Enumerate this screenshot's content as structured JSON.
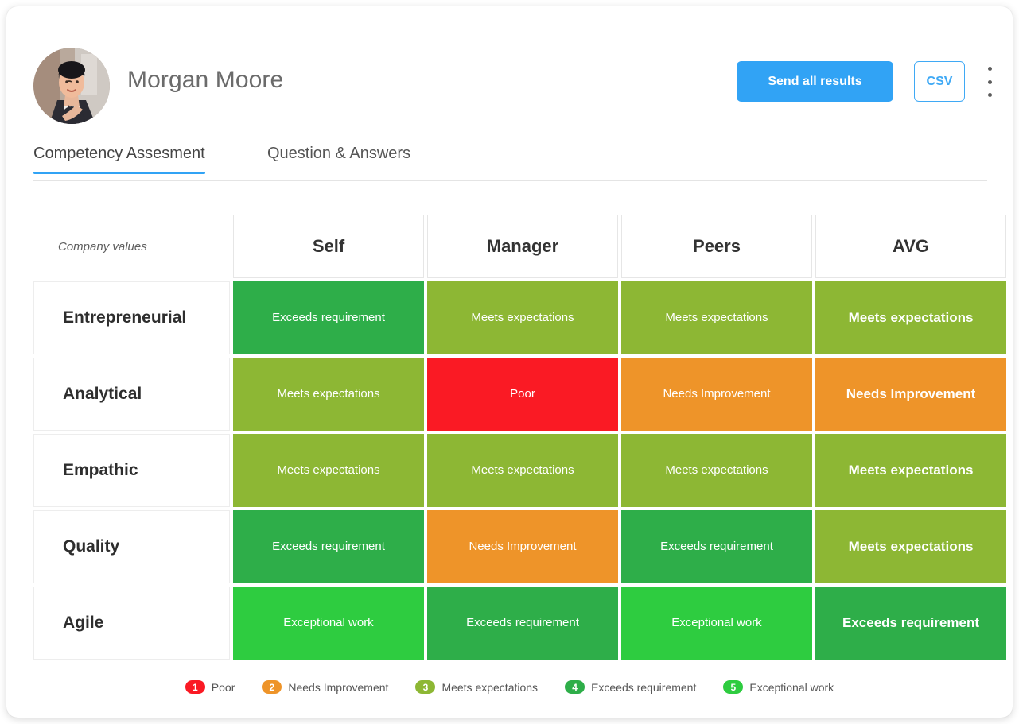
{
  "header": {
    "person_name": "Morgan Moore",
    "avatar_icon": "user-photo-avatar",
    "send_button": "Send all results",
    "csv_button": "CSV",
    "menu_icon": "kebab-menu-icon",
    "accent_color": "#31A3F5"
  },
  "tabs": [
    {
      "label": "Competency Assesment",
      "active": true
    },
    {
      "label": "Question & Answers",
      "active": false
    }
  ],
  "matrix": {
    "corner_label": "Company values",
    "columns": [
      "Self",
      "Manager",
      "Peers",
      "AVG"
    ],
    "rows": [
      {
        "name": "Entrepreneurial",
        "cells": [
          {
            "label": "Exceeds requirement",
            "level": 4,
            "color": "#2EAE49"
          },
          {
            "label": "Meets expectations",
            "level": 3,
            "color": "#8DB734"
          },
          {
            "label": "Meets expectations",
            "level": 3,
            "color": "#8DB734"
          },
          {
            "label": "Meets expectations",
            "level": 3,
            "color": "#8DB734"
          }
        ]
      },
      {
        "name": "Analytical",
        "cells": [
          {
            "label": "Meets expectations",
            "level": 3,
            "color": "#8DB734"
          },
          {
            "label": "Poor",
            "level": 1,
            "color": "#FA1A24"
          },
          {
            "label": "Needs Improvement",
            "level": 2,
            "color": "#EE9429"
          },
          {
            "label": "Needs Improvement",
            "level": 2,
            "color": "#EE9429"
          }
        ]
      },
      {
        "name": "Empathic",
        "cells": [
          {
            "label": "Meets expectations",
            "level": 3,
            "color": "#8DB734"
          },
          {
            "label": "Meets expectations",
            "level": 3,
            "color": "#8DB734"
          },
          {
            "label": "Meets expectations",
            "level": 3,
            "color": "#8DB734"
          },
          {
            "label": "Meets expectations",
            "level": 3,
            "color": "#8DB734"
          }
        ]
      },
      {
        "name": "Quality",
        "cells": [
          {
            "label": "Exceeds requirement",
            "level": 4,
            "color": "#2EAE49"
          },
          {
            "label": "Needs Improvement",
            "level": 2,
            "color": "#EE9429"
          },
          {
            "label": "Exceeds requirement",
            "level": 4,
            "color": "#2EAE49"
          },
          {
            "label": "Meets expectations",
            "level": 3,
            "color": "#8DB734"
          }
        ]
      },
      {
        "name": "Agile",
        "cells": [
          {
            "label": "Exceptional work",
            "level": 5,
            "color": "#2ECC40"
          },
          {
            "label": "Exceeds requirement",
            "level": 4,
            "color": "#2EAE49"
          },
          {
            "label": "Exceptional work",
            "level": 5,
            "color": "#2ECC40"
          },
          {
            "label": "Exceeds requirement",
            "level": 4,
            "color": "#2EAE49"
          }
        ]
      }
    ]
  },
  "legend": [
    {
      "number": "1",
      "label": "Poor",
      "color": "#FA1A24"
    },
    {
      "number": "2",
      "label": "Needs Improvement",
      "color": "#EE9429"
    },
    {
      "number": "3",
      "label": "Meets expectations",
      "color": "#8DB734"
    },
    {
      "number": "4",
      "label": "Exceeds requirement",
      "color": "#2EAE49"
    },
    {
      "number": "5",
      "label": "Exceptional work",
      "color": "#2ECC40"
    }
  ]
}
